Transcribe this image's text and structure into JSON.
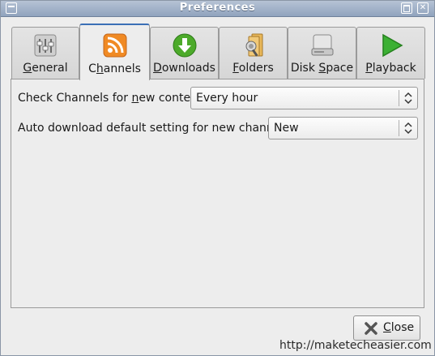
{
  "window": {
    "title": "Preferences"
  },
  "tabs": [
    {
      "pre": "",
      "mnemonic": "G",
      "post": "eneral",
      "icon": "sliders-icon"
    },
    {
      "pre": "C",
      "mnemonic": "h",
      "post": "annels",
      "icon": "rss-feed-icon"
    },
    {
      "pre": "",
      "mnemonic": "D",
      "post": "ownloads",
      "icon": "download-arrow-icon"
    },
    {
      "pre": "",
      "mnemonic": "F",
      "post": "olders",
      "icon": "folder-icon"
    },
    {
      "pre": "Disk ",
      "mnemonic": "S",
      "post": "pace",
      "icon": "hard-disk-icon"
    },
    {
      "pre": "",
      "mnemonic": "P",
      "post": "layback",
      "icon": "play-icon"
    }
  ],
  "active_tab": "Channels",
  "settings": {
    "check_label_pre": "Check Channels for ",
    "check_label_mnemonic": "n",
    "check_label_post": "ew content",
    "check_value": "Every hour",
    "auto_label": "Auto download default setting for new channels",
    "auto_value": "New"
  },
  "buttons": {
    "close_mnemonic": "C",
    "close_rest": "lose"
  },
  "watermark": "http://maketecheasier.com",
  "colors": {
    "titlebar": "#a3b4ca",
    "active_tab_accent": "#3b6fb6",
    "rss_orange": "#f08a24",
    "download_green": "#4caa2a",
    "play_green": "#3cb034"
  }
}
